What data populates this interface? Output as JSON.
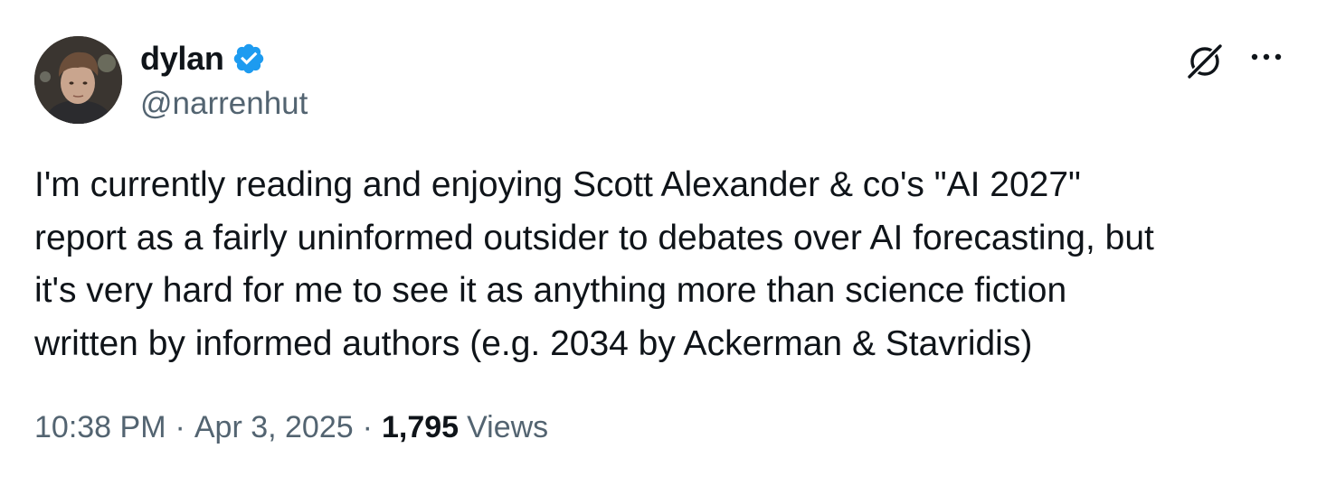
{
  "author": {
    "display_name": "dylan",
    "handle": "@narrenhut",
    "verified": true,
    "verified_color": "#1d9bf0"
  },
  "icons": {
    "grok": "grok-icon",
    "more": "more-options-icon",
    "verified": "verified-badge-icon"
  },
  "tweet": {
    "text": "I'm currently reading and enjoying Scott Alexander & co's \"AI 2027\"\nreport as a fairly uninformed outsider to debates over AI forecasting, but\nit's very hard for me to see it as anything more than science fiction\nwritten by informed authors (e.g. 2034 by Ackerman & Stavridis)"
  },
  "meta": {
    "time": "10:38 PM",
    "separator": "·",
    "date": "Apr 3, 2025",
    "views_count": "1,795",
    "views_label": "Views"
  },
  "colors": {
    "text_primary": "#0f1419",
    "text_secondary": "#536471",
    "verified_blue": "#1d9bf0"
  }
}
